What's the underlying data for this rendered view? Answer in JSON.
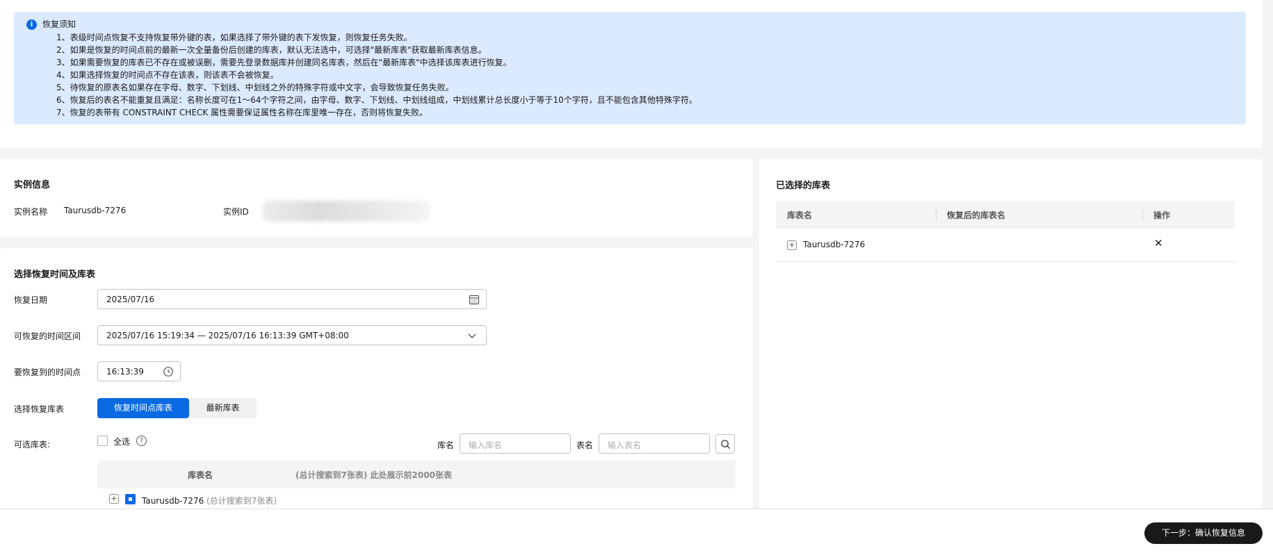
{
  "notice": {
    "title": "恢复须知",
    "items": [
      "1、表级时间点恢复不支持恢复带外键的表，如果选择了带外键的表下发恢复，则恢复任务失败。",
      "2、如果是恢复的时间点前的最新一次全量备份后创建的库表，默认无法选中，可选择\"最新库表\"获取最新库表信息。",
      "3、如果需要恢复的库表已不存在或被误删，需要先登录数据库并创建同名库表，然后在\"最新库表\"中选择该库表进行恢复。",
      "4、如果选择恢复的时间点不存在该表，则该表不会被恢复。",
      "5、待恢复的原表名如果存在字母、数字、下划线、中划线之外的特殊字符或中文字，会导致恢复任务失败。",
      "6、恢复后的表名不能重复且满足：名称长度可在1～64个字符之间，由字母、数字、下划线、中划线组成，中划线累计总长度小于等于10个字符，且不能包含其他特殊字符。",
      "7、恢复的表带有 CONSTRAINT CHECK 属性需要保证属性名称在库里唯一存在，否则将恢复失败。"
    ]
  },
  "instance": {
    "title": "实例信息",
    "name_label": "实例名称",
    "name_value": "Taurusdb-7276",
    "id_label": "实例ID"
  },
  "selection": {
    "title": "选择恢复时间及库表",
    "date_label": "恢复日期",
    "date_value": "2025/07/16",
    "range_label": "可恢复的时间区间",
    "range_value": "2025/07/16 15:19:34 — 2025/07/16 16:13:39 GMT+08:00",
    "time_label": "要恢复到的时间点",
    "time_value": "16:13:39",
    "source_label": "选择恢复库表",
    "source_options": [
      "恢复时间点库表",
      "最新库表"
    ],
    "available_label": "可选库表:",
    "select_all": "全选",
    "db_label": "库名",
    "db_placeholder": "输入库名",
    "table_label": "表名",
    "table_placeholder": "输入表名",
    "col_name": "库表名",
    "col_summary": "(总计搜索到7张表) 此处展示前2000张表",
    "row_db": "Taurusdb-7276",
    "row_count": "(总计搜索到7张表)"
  },
  "selected": {
    "title": "已选择的库表",
    "col_name": "库表名",
    "col_restored": "恢复后的库表名",
    "col_action": "操作",
    "row_db": "Taurusdb-7276"
  },
  "footer": {
    "next_label": "下一步：确认恢复信息"
  }
}
